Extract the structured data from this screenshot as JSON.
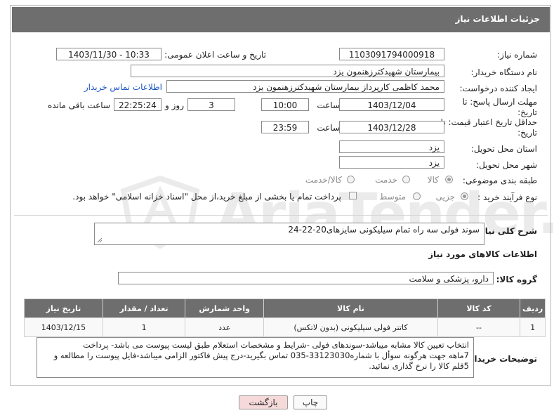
{
  "header": {
    "title": "جزئیات اطلاعات نیاز"
  },
  "fields": {
    "need_number": {
      "label": "شماره نیاز:",
      "value": "1103091794000918"
    },
    "announce_datetime": {
      "label": "تاریخ و ساعت اعلان عمومی:",
      "value": "1403/11/30 - 10:33"
    },
    "buyer_org": {
      "label": "نام دستگاه خریدار:",
      "value": "بیمارستان شهیدکترزهنمون یزد"
    },
    "requester": {
      "label": "ایجاد کننده درخواست:",
      "value": "محمد کاظمی کارپرداز بیمارستان شهیدکترزهنمون یزد",
      "contact_link": "اطلاعات تماس خریدار"
    },
    "reply_deadline": {
      "label": "مهلت ارسال پاسخ: تا تاریخ:",
      "date": "1403/12/04",
      "time_label": "ساعت",
      "time": "10:00",
      "days": "3",
      "days_label": "روز و",
      "remaining": "22:25:24",
      "remaining_label": "ساعت باقی مانده"
    },
    "price_validity": {
      "label": "حداقل تاریخ اعتبار قیمت: تا تاریخ:",
      "date": "1403/12/28",
      "time_label": "ساعت",
      "time": "23:59"
    },
    "province": {
      "label": "استان محل تحویل:",
      "value": "یزد"
    },
    "city": {
      "label": "شهر محل تحویل:",
      "value": "یزد"
    },
    "category": {
      "label": "طبقه بندی موضوعی:",
      "options": [
        "کالا",
        "خدمت",
        "کالا/خدمت"
      ],
      "selected": "کالا"
    },
    "purchase_type": {
      "label": "نوع فرآیند خرید :",
      "options": [
        "جزیی",
        "متوسط"
      ],
      "selected": "جزیی",
      "payment_note": "پرداخت تمام یا بخشی از مبلغ خرید،از محل \"اسناد خزانه اسلامی\" خواهد بود."
    }
  },
  "summary": {
    "label": "شرح کلی نیاز:",
    "value": "سوند فولی سه راه تمام سیلیکونی سایزهای20-22-24"
  },
  "goods_section": {
    "title": "اطلاعات کالاهای مورد نیاز"
  },
  "goods_group": {
    "label": "گروه کالا:",
    "value": "دارو، پزشکی و سلامت"
  },
  "table": {
    "headers": [
      "ردیف",
      "کد کالا",
      "نام کالا",
      "واحد شمارش",
      "تعداد / مقدار",
      "تاریخ نیاز"
    ],
    "rows": [
      [
        "1",
        "--",
        "کاتتر فولی سیلیکونی (بدون لاتکس)",
        "عدد",
        "1",
        "1403/12/15"
      ]
    ]
  },
  "buyer_notes": {
    "label": "توضیحات خریدار:",
    "lines": [
      "انتخاب تعیین کالا مشابه میباشد-سوندهای فولی -شرایط و مشخصات استعلام طبق لیست پیوست می باشد- پرداخت",
      "7ماهه جهت هرگونه سوأل با شماره33123030-035 تماس بگیرید-درج پیش فاکتور الزامی میباشد-فایل پیوست را مطالعه و",
      "5قلم کالا را نرخ گذاری نمائید."
    ]
  },
  "buttons": {
    "print": "چاپ",
    "back": "بازگشت"
  },
  "watermark": {
    "text": "AriaTender.neT"
  },
  "colors": {
    "header_bg": "#6e6e6e",
    "link": "#1a55c2",
    "back_bg": "#f6dada"
  }
}
